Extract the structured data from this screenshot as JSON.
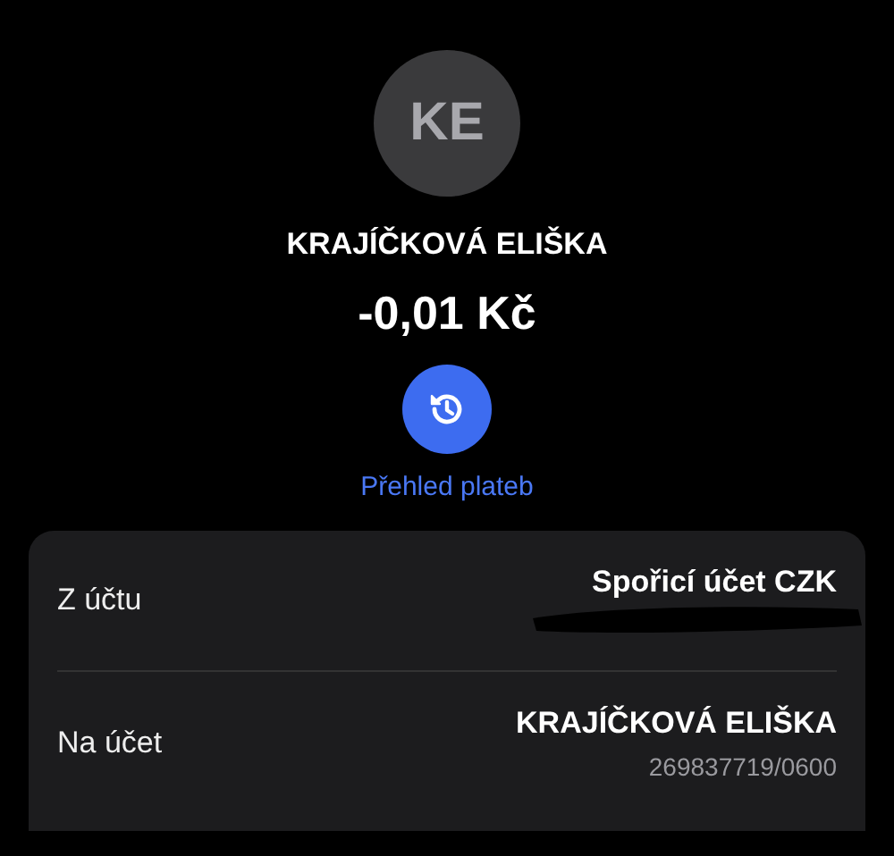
{
  "contact": {
    "initials": "KE",
    "name": "KRAJÍČKOVÁ ELIŠKA"
  },
  "amount": "-0,01 Kč",
  "history_link": "Přehled plateb",
  "details": [
    {
      "label": "Z účtu",
      "value": "Spořicí účet CZK",
      "redacted": true
    },
    {
      "label": "Na účet",
      "value": "KRAJÍČKOVÁ ELIŠKA",
      "sub": "269837719/0600",
      "redacted": false
    }
  ]
}
